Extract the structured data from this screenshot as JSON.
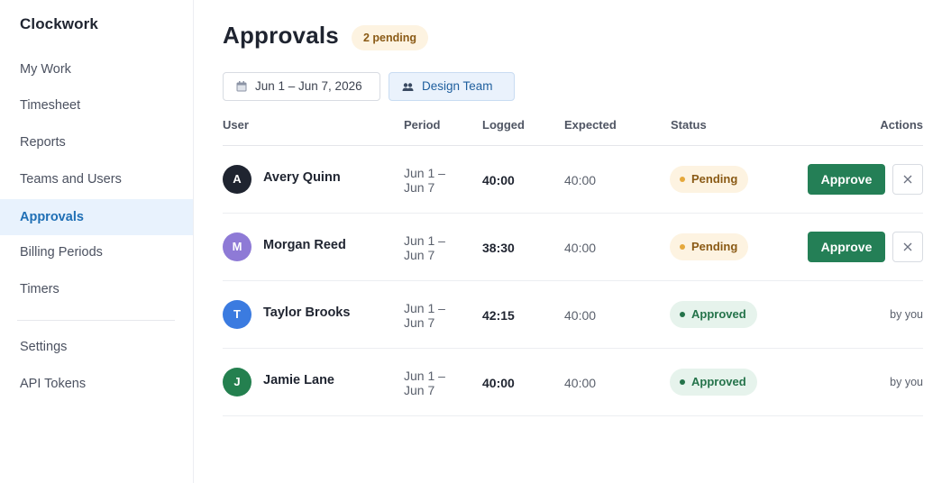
{
  "app": {
    "brand": "Clockwork"
  },
  "sidebar": {
    "items": [
      {
        "label": "My Work"
      },
      {
        "label": "Timesheet"
      },
      {
        "label": "Reports"
      },
      {
        "label": "Teams and Users"
      },
      {
        "label": "Approvals",
        "active": true
      },
      {
        "label": "Billing Periods"
      },
      {
        "label": "Timers"
      }
    ],
    "footer_items": [
      {
        "label": "Settings"
      },
      {
        "label": "API Tokens"
      }
    ]
  },
  "header": {
    "title": "Approvals",
    "pending_badge": "2 pending"
  },
  "filters": {
    "date_range": "Jun 1 – Jun 7, 2026",
    "date_icon": "calendar-icon",
    "team": "Design Team",
    "team_icon": "users-icon"
  },
  "table": {
    "columns": [
      "User",
      "Period",
      "Logged",
      "Expected",
      "Status",
      "Actions"
    ],
    "rows": [
      {
        "initial": "A",
        "avatar_color": "#1f2430",
        "name": "Avery Quinn",
        "period_line1": "Jun 1 –",
        "period_line2": "Jun 7",
        "logged": "40:00",
        "expected": "40:00",
        "status": "Pending",
        "action": "Approve",
        "reject_icon": "close-icon"
      },
      {
        "initial": "M",
        "avatar_color": "#8e7ad6",
        "name": "Morgan Reed",
        "period_line1": "Jun 1 –",
        "period_line2": "Jun 7",
        "logged": "38:30",
        "expected": "40:00",
        "status": "Pending",
        "action": "Approve",
        "reject_icon": "close-icon"
      },
      {
        "initial": "T",
        "avatar_color": "#3b7be0",
        "name": "Taylor Brooks",
        "period_line1": "Jun 1 –",
        "period_line2": "Jun 7",
        "logged": "42:15",
        "expected": "40:00",
        "status": "Approved",
        "approved_by": "by you"
      },
      {
        "initial": "J",
        "avatar_color": "#24804f",
        "name": "Jamie Lane",
        "period_line1": "Jun 1 –",
        "period_line2": "Jun 7",
        "logged": "40:00",
        "expected": "40:00",
        "status": "Approved",
        "approved_by": "by you"
      }
    ]
  },
  "colors": {
    "accent": "#1f6fb5",
    "approve": "#247f56",
    "pending": "#e5a83c",
    "approved": "#24734a"
  }
}
